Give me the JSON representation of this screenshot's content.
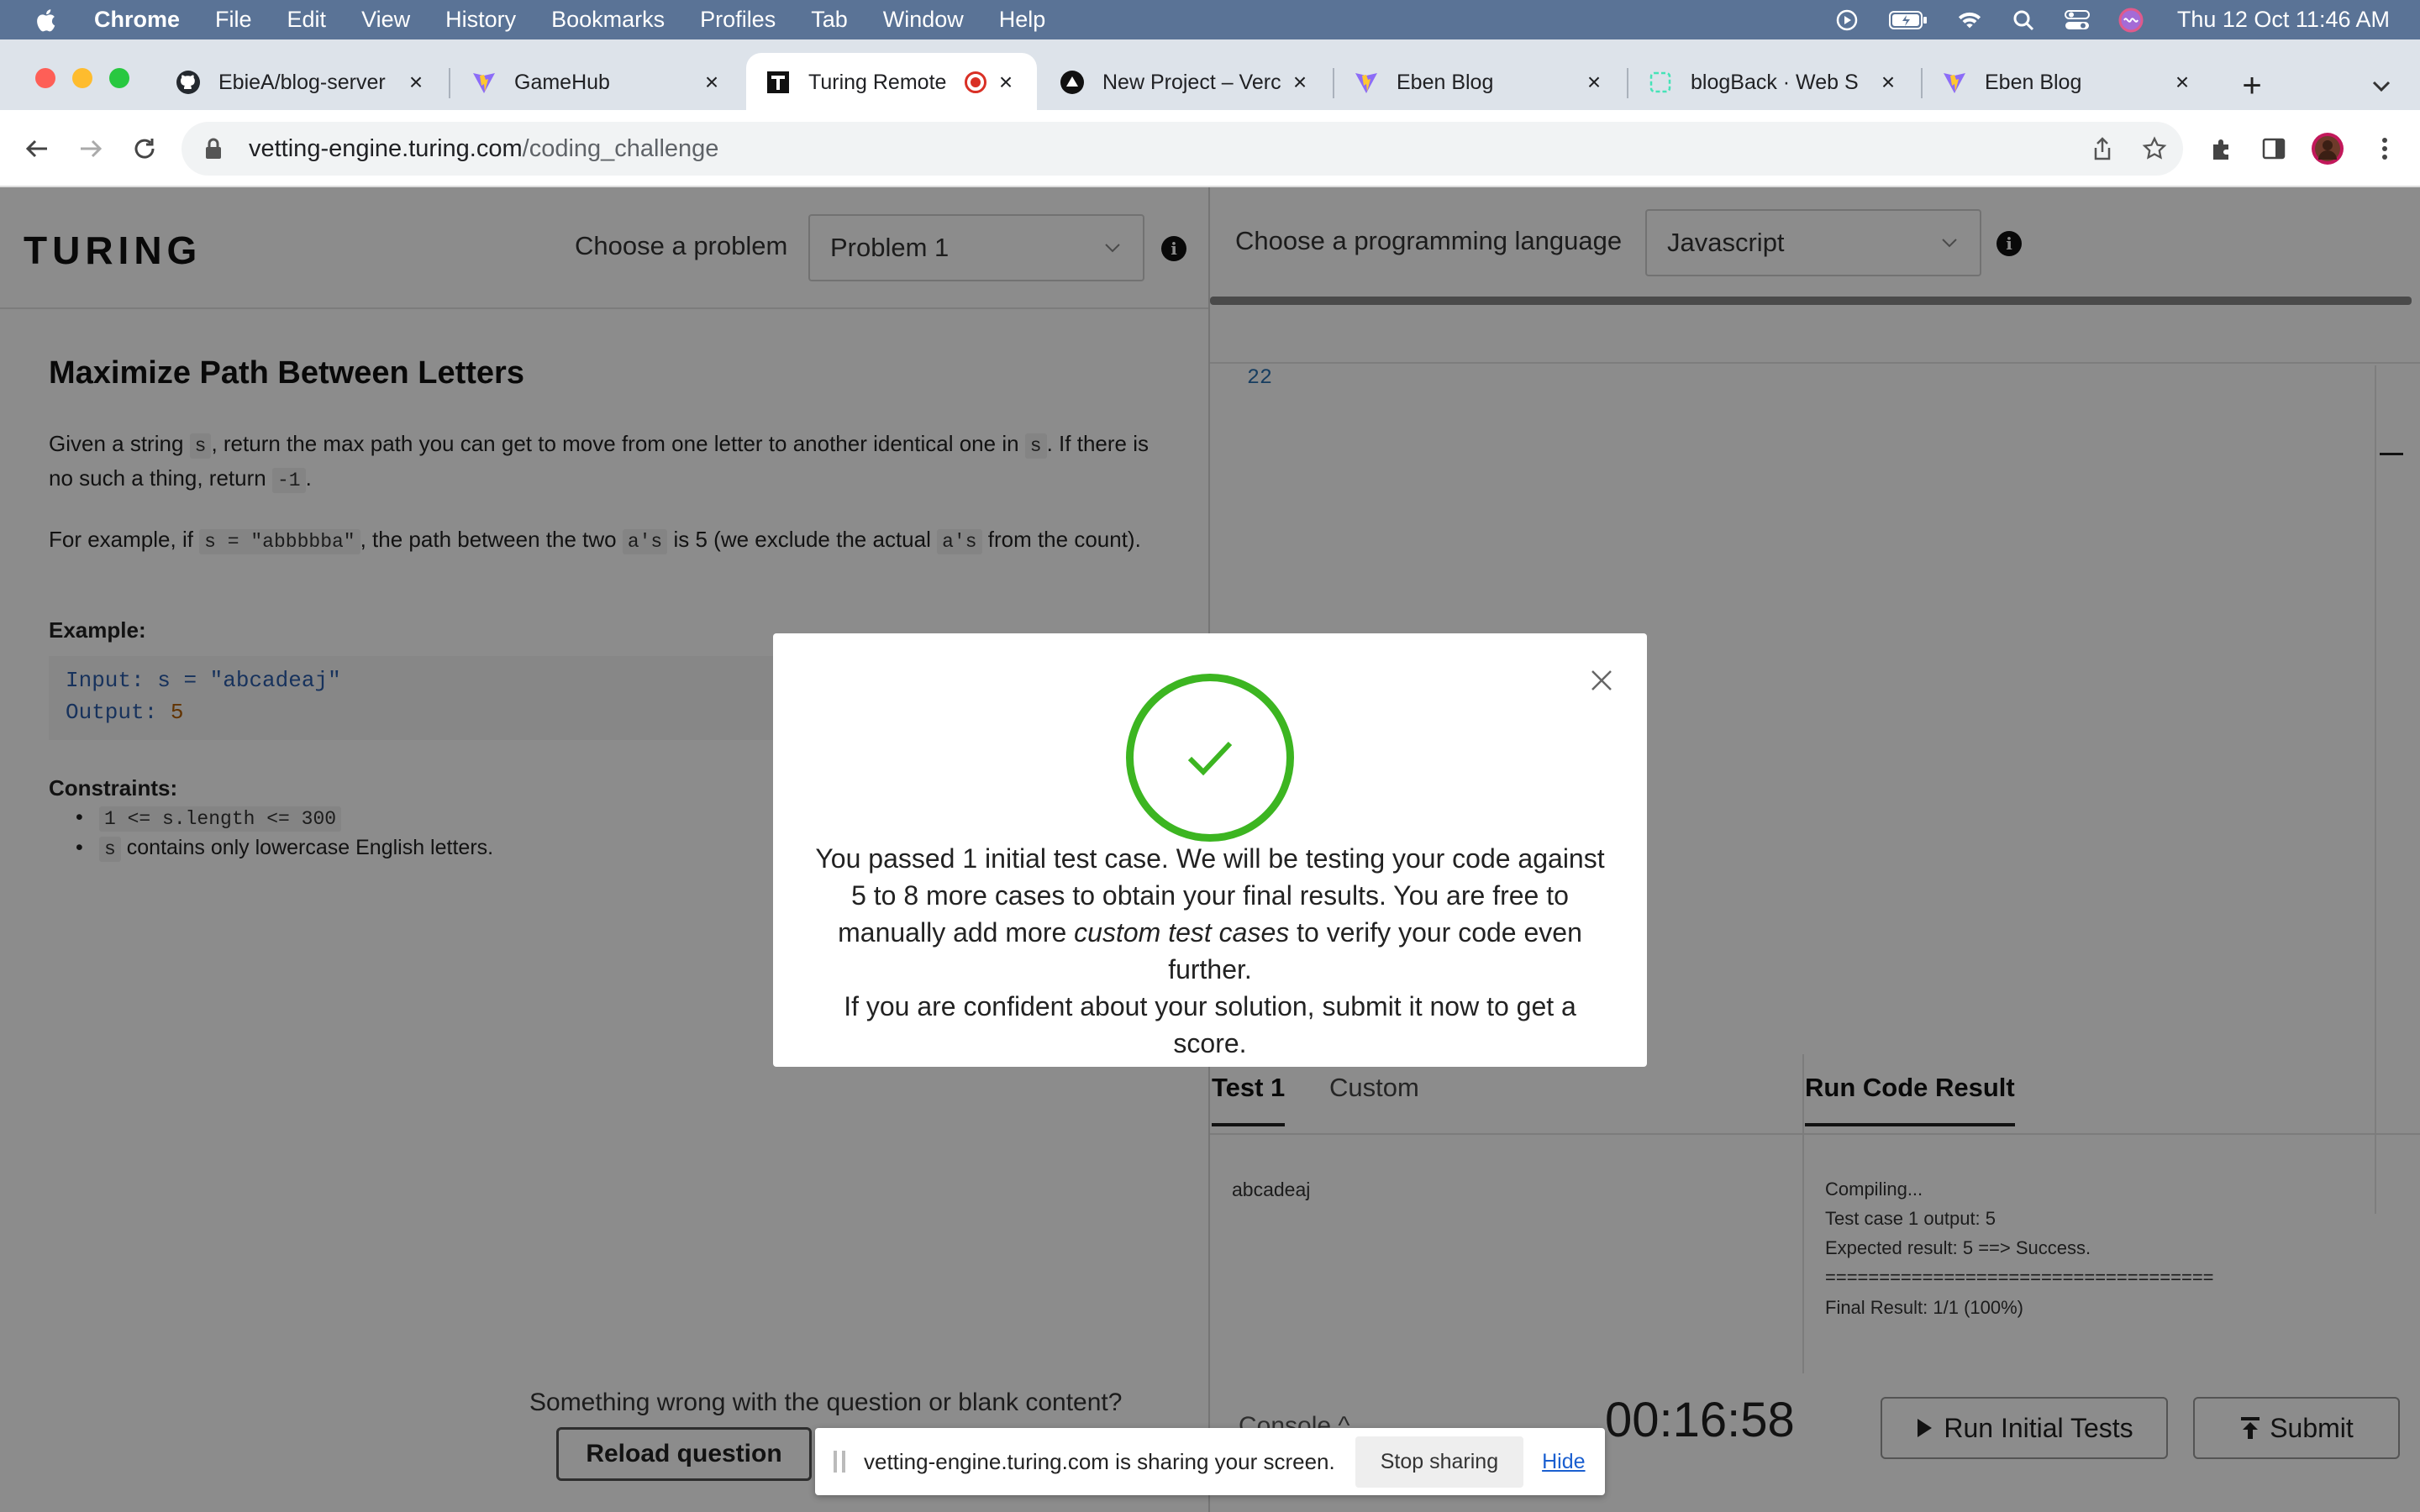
{
  "menubar": {
    "app": "Chrome",
    "items": [
      "File",
      "Edit",
      "View",
      "History",
      "Bookmarks",
      "Profiles",
      "Tab",
      "Window",
      "Help"
    ],
    "clock": "Thu 12 Oct  11:46 AM"
  },
  "tabs": [
    {
      "title": "EbieA/blog-server",
      "icon": "github-icon"
    },
    {
      "title": "GameHub",
      "icon": "vite-icon"
    },
    {
      "title": "Turing Remote",
      "icon": "turing-icon"
    },
    {
      "title": "New Project – Verc",
      "icon": "vercel-icon"
    },
    {
      "title": "Eben Blog",
      "icon": "vite-icon"
    },
    {
      "title": "blogBack · Web S",
      "icon": "render-icon"
    },
    {
      "title": "Eben Blog",
      "icon": "vite-icon"
    }
  ],
  "address": {
    "domain": "vetting-engine.turing.com",
    "path": "/coding_challenge"
  },
  "page": {
    "logo": "TURING",
    "choose_problem_label": "Choose a problem",
    "problem_select": "Problem 1",
    "choose_language_label": "Choose a programming language",
    "language_select": "Javascript",
    "problem": {
      "title": "Maximize Path Between Letters",
      "p1_a": "Given a string ",
      "p1_code1": "s",
      "p1_b": ", return the max path you can get to move from one letter to another identical one in ",
      "p1_code2": "s",
      "p1_c": ". If there is no such a thing, return ",
      "p1_code3": "-1",
      "p1_d": ".",
      "p2_a": "For example, if ",
      "p2_code1": "s = \"abbbbba\"",
      "p2_b": ", the path between the two ",
      "p2_code2": "a's",
      "p2_c": " is 5 (we exclude the actual ",
      "p2_code3": "a's",
      "p2_d": " from the count).",
      "example_label": "Example:",
      "example_input_key": "Input:",
      "example_input_val": "s = \"abcadeaj\"",
      "example_output_key": "Output:",
      "example_output_val": "5",
      "constraints_label": "Constraints:",
      "constraint1_code": "1 <= s.length <= 300",
      "constraint2_code": "s",
      "constraint2_text": " contains only lowercase English letters."
    },
    "help_text": "Something wrong with the question or blank content?",
    "reload_button": "Reload question",
    "editor_line": "22",
    "tab_test1": "Test 1",
    "tab_custom": "Custom",
    "tab_result": "Run Code Result",
    "test_input": "abcadeaj",
    "result_lines": [
      "Compiling...",
      "Test case 1 output: 5",
      "Expected result: 5 ==> Success.",
      "====================================",
      "Final Result: 1/1 (100%)"
    ],
    "console_toggle": "Console ^",
    "timer": "00:16:58",
    "run_button": "Run Initial Tests",
    "submit_button": "Submit"
  },
  "modal": {
    "line1": "You passed 1 initial test case. We will be testing your code against 5 to 8 more cases to obtain your final results. You are free to manually add more ",
    "emphasis": "custom test cases",
    "line2": " to verify your code even further.",
    "line3": "If you are confident about your solution, submit it now to get a score."
  },
  "sharebar": {
    "text": "vetting-engine.turing.com is sharing your screen.",
    "stop": "Stop sharing",
    "hide": "Hide"
  },
  "colors": {
    "menubar": "#5a7396",
    "success_green": "#3cb521",
    "link_blue": "#1a5fd0",
    "recording_red": "#d93025"
  }
}
